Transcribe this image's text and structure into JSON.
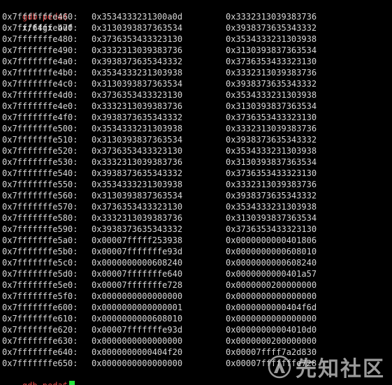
{
  "terminal": {
    "prompt": "gdb-peda$",
    "command": "x/64gx buf",
    "rows": [
      {
        "addr": "0x7fffffffe460:",
        "v1": "0x3534333231300a0d",
        "v2": "0x3332313039383736"
      },
      {
        "addr": "0x7fffffffe470:",
        "v1": "0x3130393837363534",
        "v2": "0x3938373635343332"
      },
      {
        "addr": "0x7fffffffe480:",
        "v1": "0x3736353433323130",
        "v2": "0x3534333231303938"
      },
      {
        "addr": "0x7fffffffe490:",
        "v1": "0x3332313039383736",
        "v2": "0x3130393837363534"
      },
      {
        "addr": "0x7fffffffe4a0:",
        "v1": "0x3938373635343332",
        "v2": "0x3736353433323130"
      },
      {
        "addr": "0x7fffffffe4b0:",
        "v1": "0x3534333231303938",
        "v2": "0x3332313039383736"
      },
      {
        "addr": "0x7fffffffe4c0:",
        "v1": "0x3130393837363534",
        "v2": "0x3938373635343332"
      },
      {
        "addr": "0x7fffffffe4d0:",
        "v1": "0x3736353433323130",
        "v2": "0x3534333231303938"
      },
      {
        "addr": "0x7fffffffe4e0:",
        "v1": "0x3332313039383736",
        "v2": "0x3130393837363534"
      },
      {
        "addr": "0x7fffffffe4f0:",
        "v1": "0x3938373635343332",
        "v2": "0x3736353433323130"
      },
      {
        "addr": "0x7fffffffe500:",
        "v1": "0x3534333231303938",
        "v2": "0x3332313039383736"
      },
      {
        "addr": "0x7fffffffe510:",
        "v1": "0x3130393837363534",
        "v2": "0x3938373635343332"
      },
      {
        "addr": "0x7fffffffe520:",
        "v1": "0x3736353433323130",
        "v2": "0x3534333231303938"
      },
      {
        "addr": "0x7fffffffe530:",
        "v1": "0x3332313039383736",
        "v2": "0x3130393837363534"
      },
      {
        "addr": "0x7fffffffe540:",
        "v1": "0x3938373635343332",
        "v2": "0x3736353433323130"
      },
      {
        "addr": "0x7fffffffe550:",
        "v1": "0x3534333231303938",
        "v2": "0x3332313039383736"
      },
      {
        "addr": "0x7fffffffe560:",
        "v1": "0x3130393837363534",
        "v2": "0x3938373635343332"
      },
      {
        "addr": "0x7fffffffe570:",
        "v1": "0x3736353433323130",
        "v2": "0x3534333231303938"
      },
      {
        "addr": "0x7fffffffe580:",
        "v1": "0x3332313039383736",
        "v2": "0x3130393837363534"
      },
      {
        "addr": "0x7fffffffe590:",
        "v1": "0x3938373635343332",
        "v2": "0x3736353433323130"
      },
      {
        "addr": "0x7fffffffe5a0:",
        "v1": "0x00007fffff253938",
        "v2": "0x0000000000401806"
      },
      {
        "addr": "0x7fffffffe5b0:",
        "v1": "0x00007fffffffe93d",
        "v2": "0x0000000000608010"
      },
      {
        "addr": "0x7fffffffe5c0:",
        "v1": "0x0000000000608240",
        "v2": "0x0000000000608240"
      },
      {
        "addr": "0x7fffffffe5d0:",
        "v1": "0x00007fffffffe640",
        "v2": "0x0000000000401a57"
      },
      {
        "addr": "0x7fffffffe5e0:",
        "v1": "0x00007fffffffe728",
        "v2": "0x0000000200000000"
      },
      {
        "addr": "0x7fffffffe5f0:",
        "v1": "0x0000000000000000",
        "v2": "0x0000000000000000"
      },
      {
        "addr": "0x7fffffffe600:",
        "v1": "0x0000000000000001",
        "v2": "0x0000000000404f6d"
      },
      {
        "addr": "0x7fffffffe610:",
        "v1": "0x0000000000608010",
        "v2": "0x0000000000000000"
      },
      {
        "addr": "0x7fffffffe620:",
        "v1": "0x00007fffffffe93d",
        "v2": "0x00000000004010d0"
      },
      {
        "addr": "0x7fffffffe630:",
        "v1": "0x0000000000000000",
        "v2": "0x0000000200000000"
      },
      {
        "addr": "0x7fffffffe640:",
        "v1": "0x0000000000404f20",
        "v2": "0x00007ffff7a2d830"
      },
      {
        "addr": "0x7fffffffe650:",
        "v1": "0x0000000000000000",
        "v2": "0x00007fffffffe728"
      }
    ]
  },
  "watermark": {
    "text": "先知社区",
    "logo_icon": "xianzhi-logo-icon"
  },
  "colors": {
    "background": "#000000",
    "text": "#d6d6d6",
    "prompt": "#e84b4b",
    "cursor": "#22e33a"
  }
}
